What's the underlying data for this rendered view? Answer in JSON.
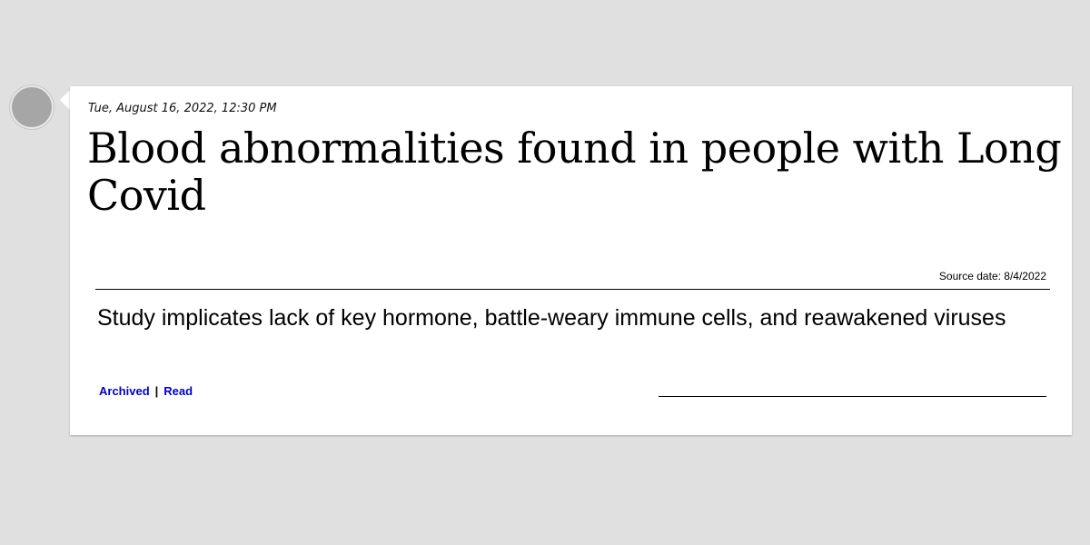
{
  "entry": {
    "timestamp": "Tue, August 16, 2022, 12:30 PM",
    "headline": "Blood abnormalities found in people with Long Covid",
    "source_date": "Source date: 8/4/2022",
    "subtitle": "Study implicates lack of key hormone, battle-weary immune cells, and reawakened viruses",
    "links": {
      "archived_label": "Archived",
      "separator": "|",
      "read_label": "Read"
    }
  },
  "colors": {
    "background": "#e0e0e0",
    "card": "#ffffff",
    "link": "#0000cc",
    "timeline_dot": "#a6a6a6"
  },
  "icons": {
    "timeline_marker": "timeline-dot-icon"
  }
}
